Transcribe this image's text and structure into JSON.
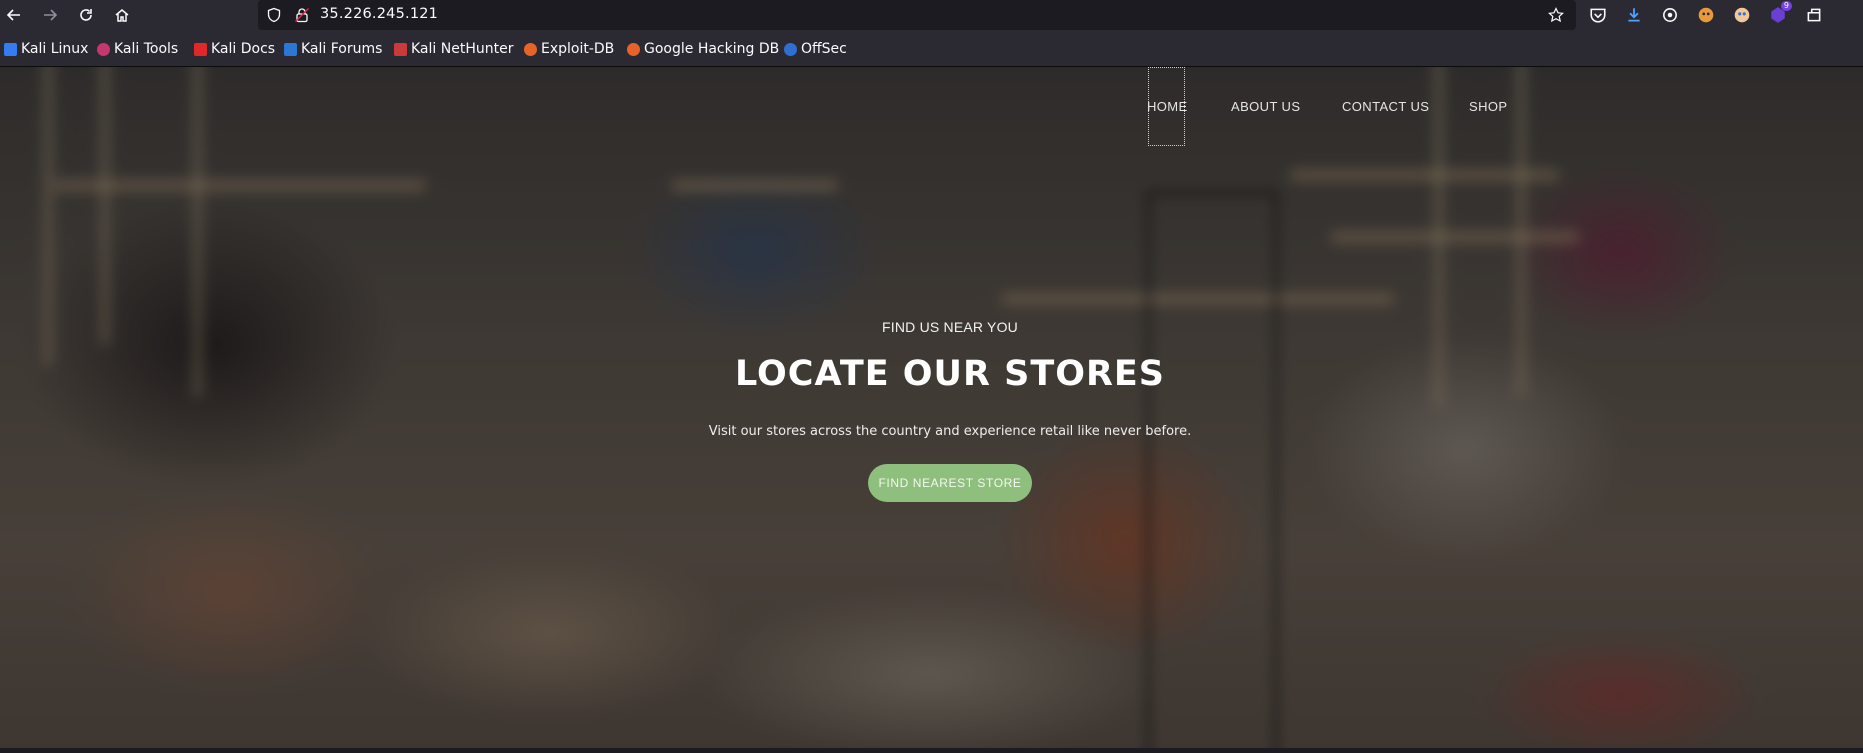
{
  "browser": {
    "url": "35.226.245.121",
    "extension_badge": "9",
    "icons": [
      "back-icon",
      "forward-icon",
      "reload-icon",
      "home-icon",
      "shield-icon",
      "lock-icon",
      "star-icon",
      "pocket-icon",
      "download-icon",
      "settings-icon",
      "extension-icon",
      "extension-icon",
      "extension-icon",
      "extensions-menu-icon"
    ]
  },
  "bookmarks": [
    {
      "label": "Kali Linux",
      "color": "#367bf0"
    },
    {
      "label": "Kali Tools",
      "color": "#c2386f"
    },
    {
      "label": "Kali Docs",
      "color": "#e02828"
    },
    {
      "label": "Kali Forums",
      "color": "#2d76d2"
    },
    {
      "label": "Kali NetHunter",
      "color": "#c93b3b"
    },
    {
      "label": "Exploit-DB",
      "color": "#e8632a"
    },
    {
      "label": "Google Hacking DB",
      "color": "#e8632a"
    },
    {
      "label": "OffSec",
      "color": "#2f6fd1"
    }
  ],
  "nav": {
    "home": "HOME",
    "about": "ABOUT US",
    "contact": "CONTACT US",
    "shop": "SHOP"
  },
  "hero": {
    "kicker": "FIND US NEAR YOU",
    "title": "LOCATE OUR STORES",
    "subtitle": "Visit our stores across the country and experience retail like never before.",
    "cta": "FIND NEAREST STORE"
  },
  "colors": {
    "accent": "#8fbf7d",
    "toolbar": "#2b2a33"
  }
}
